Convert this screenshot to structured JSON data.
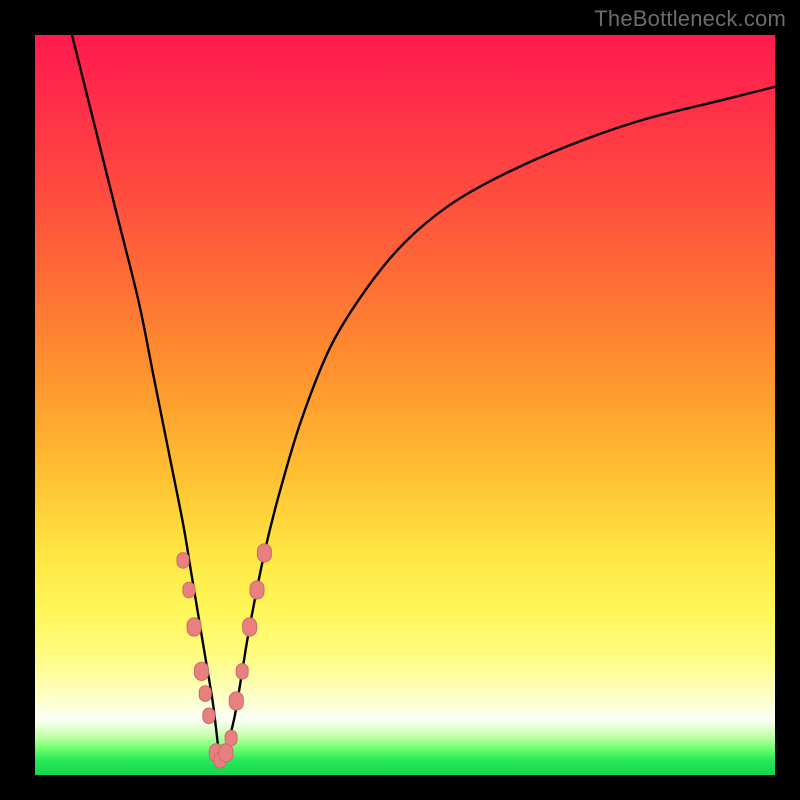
{
  "watermark": {
    "text": "TheBottleneck.com"
  },
  "colors": {
    "curve_stroke": "#000000",
    "marker_fill": "#e98080",
    "marker_stroke": "#c96a6a",
    "background": "#000000",
    "gradient_top": "#ff1a4d",
    "gradient_mid": "#ffe642",
    "gradient_bottom": "#17d64b"
  },
  "chart_data": {
    "type": "line",
    "title": "",
    "xlabel": "",
    "ylabel": "",
    "xlim": [
      0,
      100
    ],
    "ylim": [
      0,
      100
    ],
    "legend": false,
    "grid": false,
    "series": [
      {
        "name": "bottleneck-curve",
        "x": [
          5,
          8,
          11,
          14,
          16,
          18,
          20,
          21,
          22,
          23,
          24,
          24.5,
          25,
          25.5,
          26,
          27,
          28,
          29,
          31,
          33,
          36,
          40,
          45,
          50,
          56,
          63,
          72,
          82,
          92,
          100
        ],
        "values": [
          100,
          88,
          76,
          64,
          54,
          44,
          34,
          28,
          22,
          16,
          10,
          6,
          2,
          2,
          4,
          8,
          14,
          20,
          30,
          38,
          48,
          58,
          66,
          72,
          77,
          81,
          85,
          88.5,
          91,
          93
        ]
      }
    ],
    "markers": [
      {
        "x": 20.0,
        "y": 29,
        "r": 6
      },
      {
        "x": 20.8,
        "y": 25,
        "r": 6
      },
      {
        "x": 21.5,
        "y": 20,
        "r": 7
      },
      {
        "x": 22.5,
        "y": 14,
        "r": 7
      },
      {
        "x": 23.0,
        "y": 11,
        "r": 6
      },
      {
        "x": 23.5,
        "y": 8,
        "r": 6
      },
      {
        "x": 24.5,
        "y": 3,
        "r": 7
      },
      {
        "x": 25.0,
        "y": 2,
        "r": 6
      },
      {
        "x": 25.8,
        "y": 3,
        "r": 7
      },
      {
        "x": 26.5,
        "y": 5,
        "r": 6
      },
      {
        "x": 27.2,
        "y": 10,
        "r": 7
      },
      {
        "x": 28.0,
        "y": 14,
        "r": 6
      },
      {
        "x": 29.0,
        "y": 20,
        "r": 7
      },
      {
        "x": 30.0,
        "y": 25,
        "r": 7
      },
      {
        "x": 31.0,
        "y": 30,
        "r": 7
      }
    ],
    "annotations": []
  }
}
